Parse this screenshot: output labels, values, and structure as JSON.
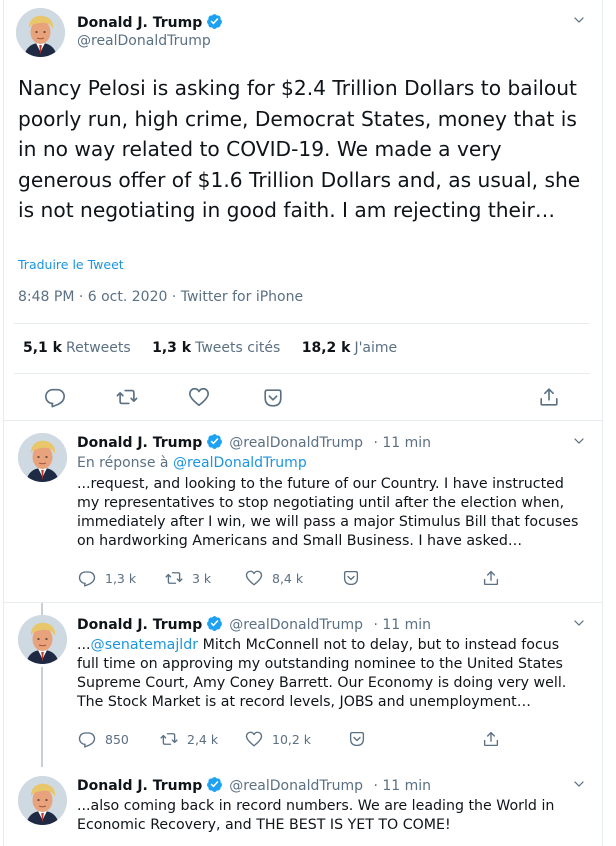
{
  "main_tweet": {
    "author_name": "Donald J. Trump",
    "author_handle": "@realDonaldTrump",
    "text": "Nancy Pelosi is asking for $2.4 Trillion Dollars to bailout poorly run, high crime, Democrat States, money that is in no way related to COVID-19. We made a very generous offer of $1.6 Trillion Dollars and, as usual, she is not negotiating in good faith. I am rejecting their…",
    "translate_label": "Traduire le Tweet",
    "meta": "8:48 PM · 6 oct. 2020 · Twitter for iPhone",
    "stats": {
      "retweets_count": "5,1 k",
      "retweets_label": "Retweets",
      "quotes_count": "1,3 k",
      "quotes_label": "Tweets cités",
      "likes_count": "18,2 k",
      "likes_label": "J'aime"
    }
  },
  "replies": [
    {
      "author_name": "Donald J. Trump",
      "author_handle": "@realDonaldTrump",
      "time": "· 11 min",
      "reply_to_prefix": "En réponse à",
      "reply_to_handle": "@realDonaldTrump",
      "text": "...request, and looking to the future of our Country. I have instructed my representatives to stop negotiating until after the election when, immediately after I win, we will pass a major Stimulus Bill that focuses on hardworking Americans and Small Business. I have asked…",
      "reply_count": "1,3 k",
      "retweet_count": "3 k",
      "like_count": "8,4 k"
    },
    {
      "author_name": "Donald J. Trump",
      "author_handle": "@realDonaldTrump",
      "time": "· 11 min",
      "text_prefix": "...",
      "mention": "@senatemajldr",
      "text": " Mitch McConnell not to delay, but to instead focus full time on approving my outstanding nominee to the United States Supreme Court, Amy Coney Barrett. Our Economy is doing very well. The Stock Market is at record levels, JOBS and unemployment…",
      "reply_count": "850",
      "retweet_count": "2,4 k",
      "like_count": "10,2 k"
    },
    {
      "author_name": "Donald J. Trump",
      "author_handle": "@realDonaldTrump",
      "time": "· 11 min",
      "text": "...also coming back in record numbers. We are leading the World in Economic Recovery, and THE BEST IS YET TO COME!"
    }
  ],
  "colors": {
    "accent": "#1b95e0",
    "muted": "#5b7083",
    "text": "#0f1419",
    "border": "#e6ecf0"
  },
  "icons": [
    "chevron-down-icon",
    "verified-badge-icon",
    "reply-icon",
    "retweet-icon",
    "like-icon",
    "caret-icon",
    "share-icon"
  ]
}
